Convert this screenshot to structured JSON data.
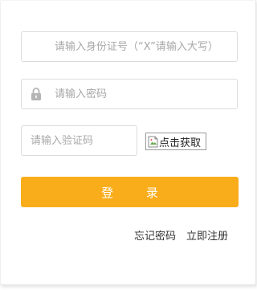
{
  "form": {
    "id_number": {
      "placeholder": "请输入身份证号（“X”请输入大写）",
      "value": ""
    },
    "password": {
      "placeholder": "请输入密码",
      "value": "",
      "icon": "lock-icon"
    },
    "captcha": {
      "placeholder": "请输入验证码",
      "value": "",
      "image_alt": "点击获取",
      "image_icon": "broken-image-icon"
    },
    "login_label": "登 录",
    "forgot_password_label": "忘记密码",
    "register_label": "立即注册"
  },
  "colors": {
    "accent": "#f9ad1b",
    "border": "#dcdcdc",
    "placeholder": "#a8a8a8",
    "text": "#333333"
  }
}
